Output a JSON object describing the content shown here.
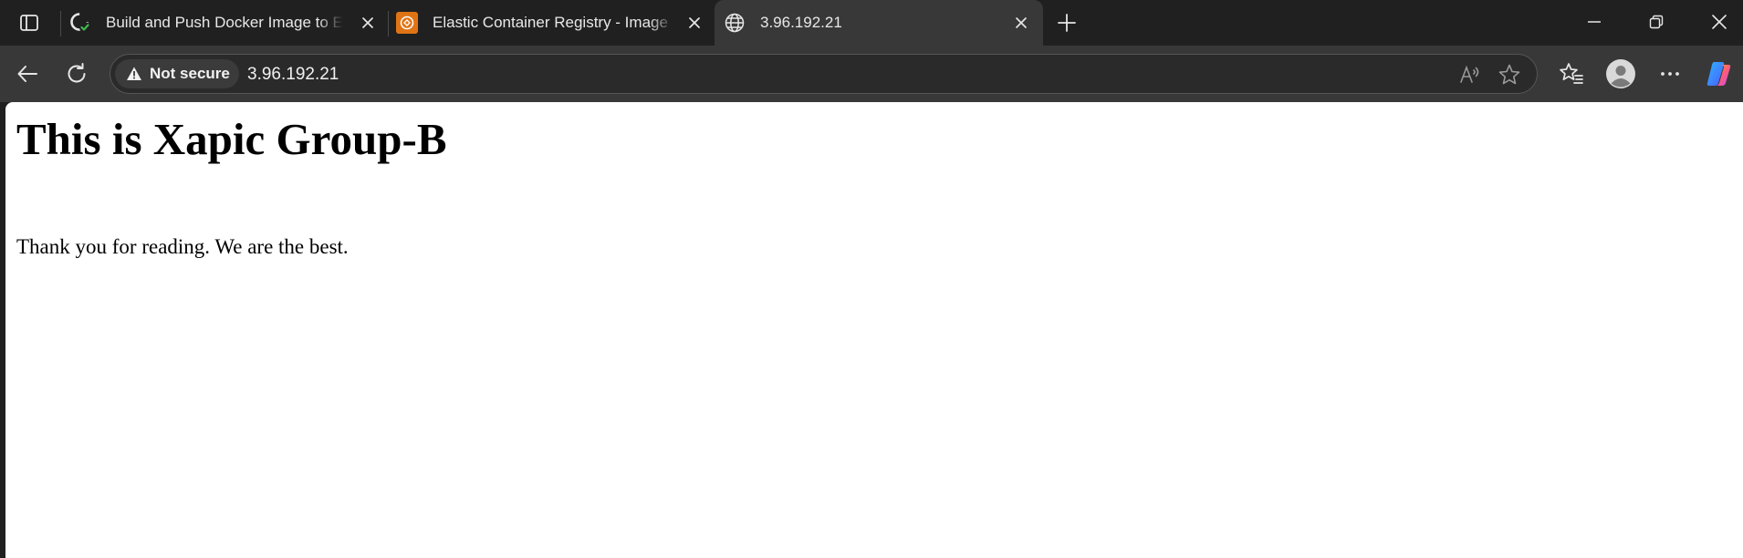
{
  "browser": {
    "tabs": [
      {
        "title": "Build and Push Docker Image to E",
        "icon": "github-actions-icon",
        "active": false
      },
      {
        "title": "Elastic Container Registry - Image",
        "icon": "aws-ecr-icon",
        "active": false
      },
      {
        "title": "3.96.192.21",
        "icon": "globe-icon",
        "active": true
      }
    ],
    "address_bar": {
      "security_label": "Not secure",
      "url": "3.96.192.21"
    },
    "icons": {
      "tab_actions": "tab-actions-icon",
      "new_tab": "plus-icon",
      "back": "back-arrow-icon",
      "refresh": "refresh-icon",
      "read_aloud": "read-aloud-icon",
      "favorite": "star-icon",
      "favorites": "favorites-icon",
      "profile": "avatar-icon",
      "menu": "more-icon",
      "copilot": "copilot-icon"
    },
    "colors": {
      "frame": "#202020",
      "toolbar": "#383838",
      "ecr_orange": "#e07415",
      "github_check": "#3fb950"
    }
  },
  "page": {
    "heading": "This is Xapic Group-B",
    "paragraph": "Thank you for reading. We are the best."
  }
}
